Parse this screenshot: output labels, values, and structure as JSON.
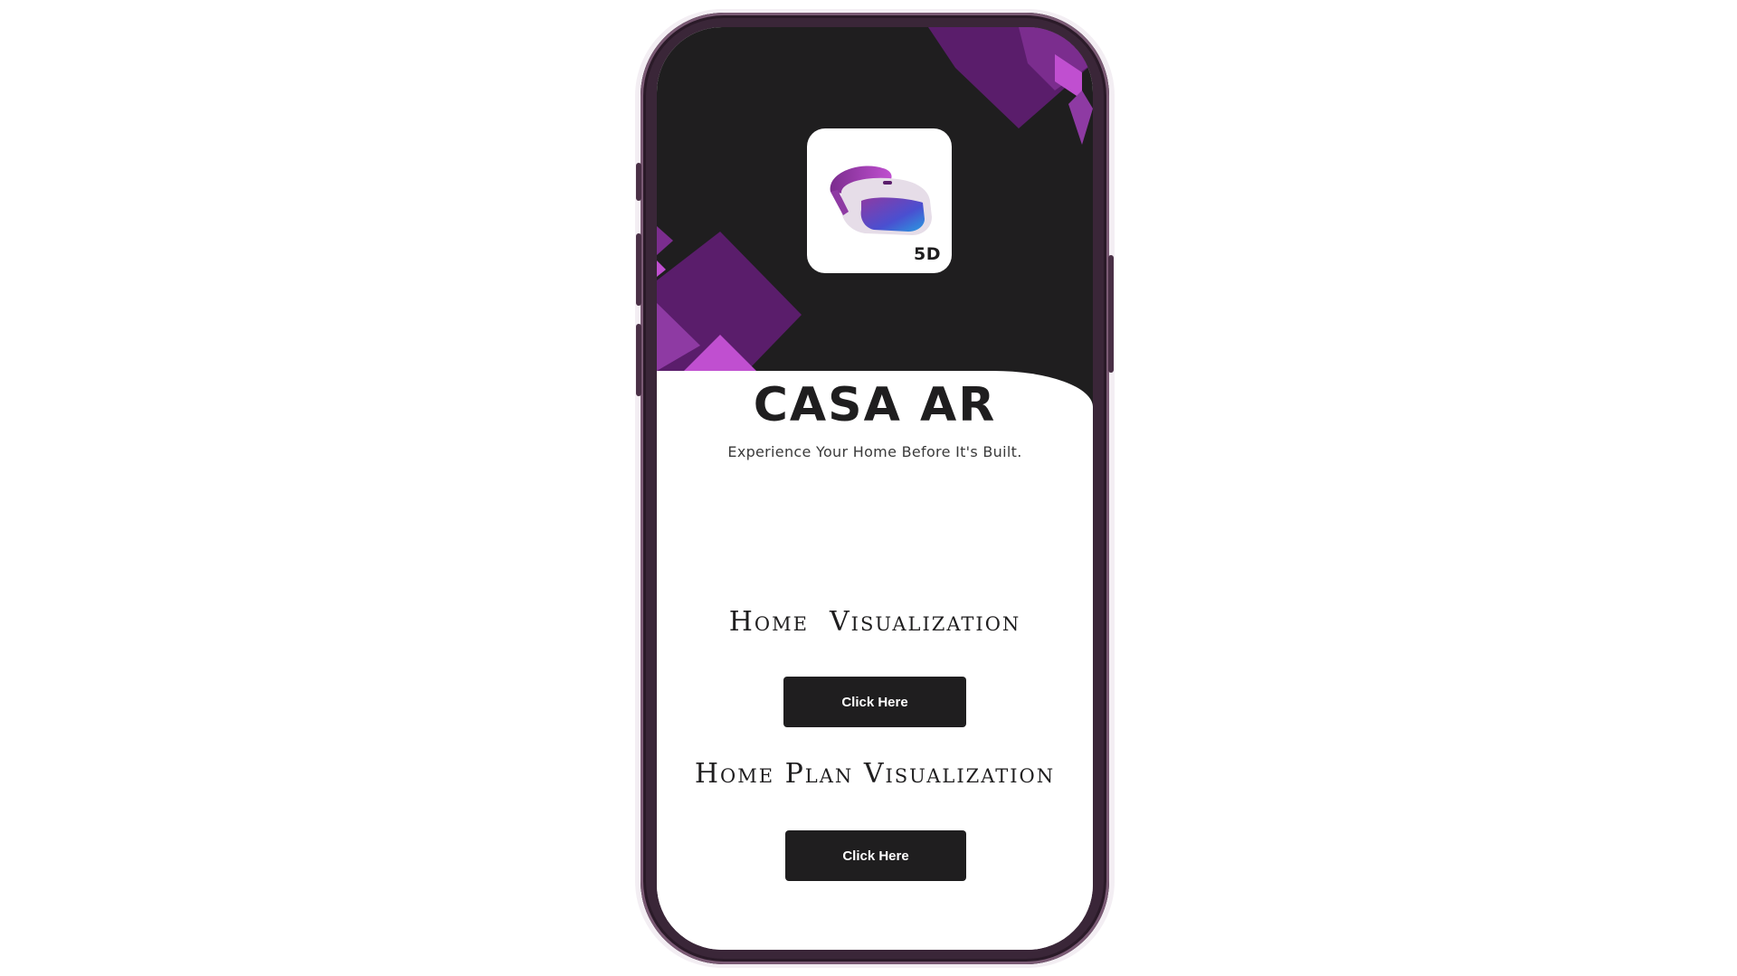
{
  "app": {
    "title": "CASA AR",
    "tagline": "Experience Your Home Before It's Built.",
    "icon_badge": "5D",
    "icon_name": "vr-headset-icon"
  },
  "sections": [
    {
      "title": "Home  Visualization",
      "button_label": "Click Here"
    },
    {
      "title": "Home Plan Visualization",
      "button_label": "Click Here"
    }
  ],
  "colors": {
    "background_dark": "#1f1e1f",
    "accent_purple": "#7b2d8e",
    "accent_light_purple": "#c04fd0",
    "button_bg": "#1f1e1f",
    "button_text": "#ffffff",
    "phone_frame": "#3a2638"
  }
}
